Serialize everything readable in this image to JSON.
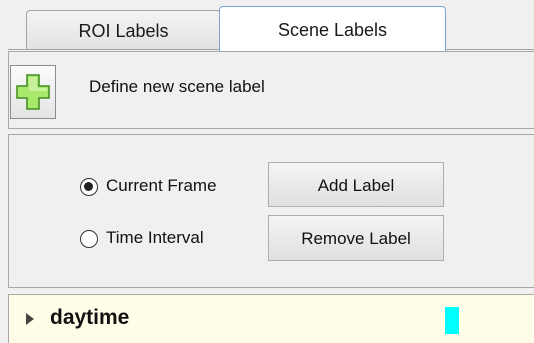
{
  "tabs": [
    {
      "label": "ROI Labels",
      "selected": false
    },
    {
      "label": "Scene Labels",
      "selected": true
    }
  ],
  "define_row": {
    "icon": "plus-icon",
    "label": "Define new scene label"
  },
  "mode": {
    "options": [
      {
        "label": "Current Frame",
        "checked": true
      },
      {
        "label": "Time Interval",
        "checked": false
      }
    ]
  },
  "buttons": {
    "add": "Add Label",
    "remove": "Remove Label"
  },
  "labels": [
    {
      "name": "daytime",
      "color": "#00ffff"
    }
  ]
}
